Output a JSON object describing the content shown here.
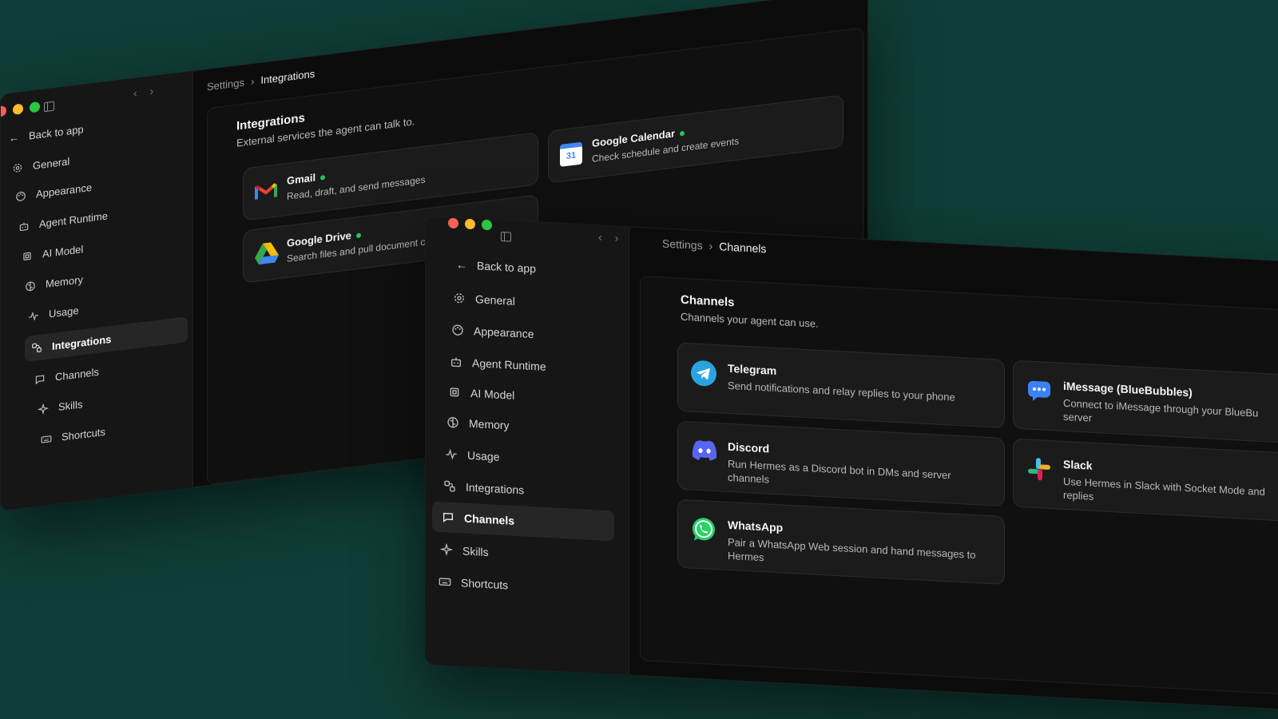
{
  "back_window": {
    "sidebar": {
      "back_label": "Back to app",
      "items": [
        {
          "label": "General",
          "icon": "gear-icon"
        },
        {
          "label": "Appearance",
          "icon": "palette-icon"
        },
        {
          "label": "Agent Runtime",
          "icon": "bot-icon"
        },
        {
          "label": "AI Model",
          "icon": "cpu-icon"
        },
        {
          "label": "Memory",
          "icon": "brain-icon"
        },
        {
          "label": "Usage",
          "icon": "activity-icon"
        },
        {
          "label": "Integrations",
          "icon": "integrations-icon",
          "active": true
        },
        {
          "label": "Channels",
          "icon": "chat-icon"
        },
        {
          "label": "Skills",
          "icon": "sparkles-icon"
        },
        {
          "label": "Shortcuts",
          "icon": "keyboard-icon"
        }
      ]
    },
    "breadcrumb": {
      "root": "Settings",
      "sep": "›",
      "current": "Integrations"
    },
    "panel": {
      "title": "Integrations",
      "subtitle": "External services the agent can talk to."
    },
    "cards": [
      {
        "name": "Gmail",
        "desc": "Read, draft, and send messages",
        "connected": true,
        "icon": "gmail-icon"
      },
      {
        "name": "Google Calendar",
        "desc": "Check schedule and create events",
        "connected": true,
        "icon": "google-calendar-icon",
        "badge": "31"
      },
      {
        "name": "Google Drive",
        "desc": "Search files and pull document conte",
        "connected": true,
        "icon": "google-drive-icon"
      }
    ]
  },
  "front_window": {
    "sidebar": {
      "back_label": "Back to app",
      "items": [
        {
          "label": "General",
          "icon": "gear-icon"
        },
        {
          "label": "Appearance",
          "icon": "palette-icon"
        },
        {
          "label": "Agent Runtime",
          "icon": "bot-icon"
        },
        {
          "label": "AI Model",
          "icon": "cpu-icon"
        },
        {
          "label": "Memory",
          "icon": "brain-icon"
        },
        {
          "label": "Usage",
          "icon": "activity-icon"
        },
        {
          "label": "Integrations",
          "icon": "integrations-icon"
        },
        {
          "label": "Channels",
          "icon": "chat-icon",
          "active": true
        },
        {
          "label": "Skills",
          "icon": "sparkles-icon"
        },
        {
          "label": "Shortcuts",
          "icon": "keyboard-icon"
        }
      ]
    },
    "breadcrumb": {
      "root": "Settings",
      "sep": "›",
      "current": "Channels"
    },
    "panel": {
      "title": "Channels",
      "subtitle": "Channels your agent can use."
    },
    "cards": [
      {
        "name": "Telegram",
        "desc": "Send notifications and relay replies to your phone",
        "icon": "telegram-icon"
      },
      {
        "name": "iMessage (BlueBubbles)",
        "desc": "Connect to iMessage through your BlueBu server",
        "icon": "imessage-icon"
      },
      {
        "name": "Discord",
        "desc": "Run Hermes as a Discord bot in DMs and server channels",
        "icon": "discord-icon"
      },
      {
        "name": "Slack",
        "desc": "Use Hermes in Slack with Socket Mode and replies",
        "icon": "slack-icon"
      },
      {
        "name": "WhatsApp",
        "desc": "Pair a WhatsApp Web session and hand messages to Hermes",
        "icon": "whatsapp-icon"
      }
    ]
  },
  "colors": {
    "background": "#103d37",
    "window": "#0c0c0c",
    "sidebar": "#161616",
    "card": "#1b1b1b",
    "connected_dot": "#22c55e",
    "telegram": "#2aa3e0",
    "discord": "#5865f2",
    "imessage": "#3b82f6",
    "whatsapp": "#25d366"
  }
}
